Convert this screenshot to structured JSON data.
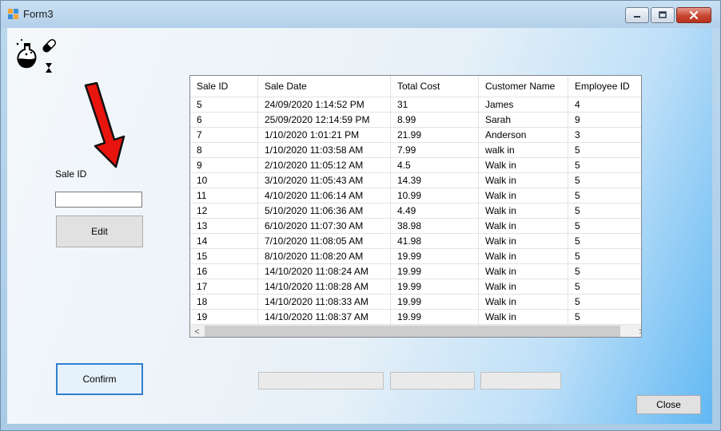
{
  "window": {
    "title": "Form3"
  },
  "form": {
    "sale_id_label": "Sale ID",
    "sale_id_value": "",
    "edit_label": "Edit",
    "confirm_label": "Confirm",
    "close_label": "Close"
  },
  "grid": {
    "columns": [
      "Sale ID",
      "Sale Date",
      "Total Cost",
      "Customer Name",
      "Employee ID"
    ],
    "rows": [
      [
        "5",
        "24/09/2020 1:14:52 PM",
        "31",
        "James",
        "4"
      ],
      [
        "6",
        "25/09/2020 12:14:59 PM",
        "8.99",
        "Sarah",
        "9"
      ],
      [
        "7",
        "1/10/2020 1:01:21 PM",
        "21.99",
        "Anderson",
        "3"
      ],
      [
        "8",
        "1/10/2020 11:03:58 AM",
        "7.99",
        "walk in",
        "5"
      ],
      [
        "9",
        "2/10/2020 11:05:12 AM",
        "4.5",
        "Walk in",
        "5"
      ],
      [
        "10",
        "3/10/2020 11:05:43 AM",
        "14.39",
        "Walk in",
        "5"
      ],
      [
        "11",
        "4/10/2020 11:06:14 AM",
        "10.99",
        "Walk in",
        "5"
      ],
      [
        "12",
        "5/10/2020 11:06:36 AM",
        "4.49",
        "Walk in",
        "5"
      ],
      [
        "13",
        "6/10/2020 11:07:30 AM",
        "38.98",
        "Walk in",
        "5"
      ],
      [
        "14",
        "7/10/2020 11:08:05 AM",
        "41.98",
        "Walk in",
        "5"
      ],
      [
        "15",
        "8/10/2020 11:08:20 AM",
        "19.99",
        "Walk in",
        "5"
      ],
      [
        "16",
        "14/10/2020 11:08:24 AM",
        "19.99",
        "Walk in",
        "5"
      ],
      [
        "17",
        "14/10/2020 11:08:28 AM",
        "19.99",
        "Walk in",
        "5"
      ],
      [
        "18",
        "14/10/2020 11:08:33 AM",
        "19.99",
        "Walk in",
        "5"
      ],
      [
        "19",
        "14/10/2020 11:08:37 AM",
        "19.99",
        "Walk in",
        "5"
      ]
    ]
  },
  "icons": {
    "app": "form-app-icon",
    "logo": "potion-pill-logo-icon",
    "arrow": "red-arrow-icon"
  },
  "colors": {
    "arrow": "#e8140e",
    "confirm_border": "#2f7fd0",
    "close_button": "#c64530"
  }
}
